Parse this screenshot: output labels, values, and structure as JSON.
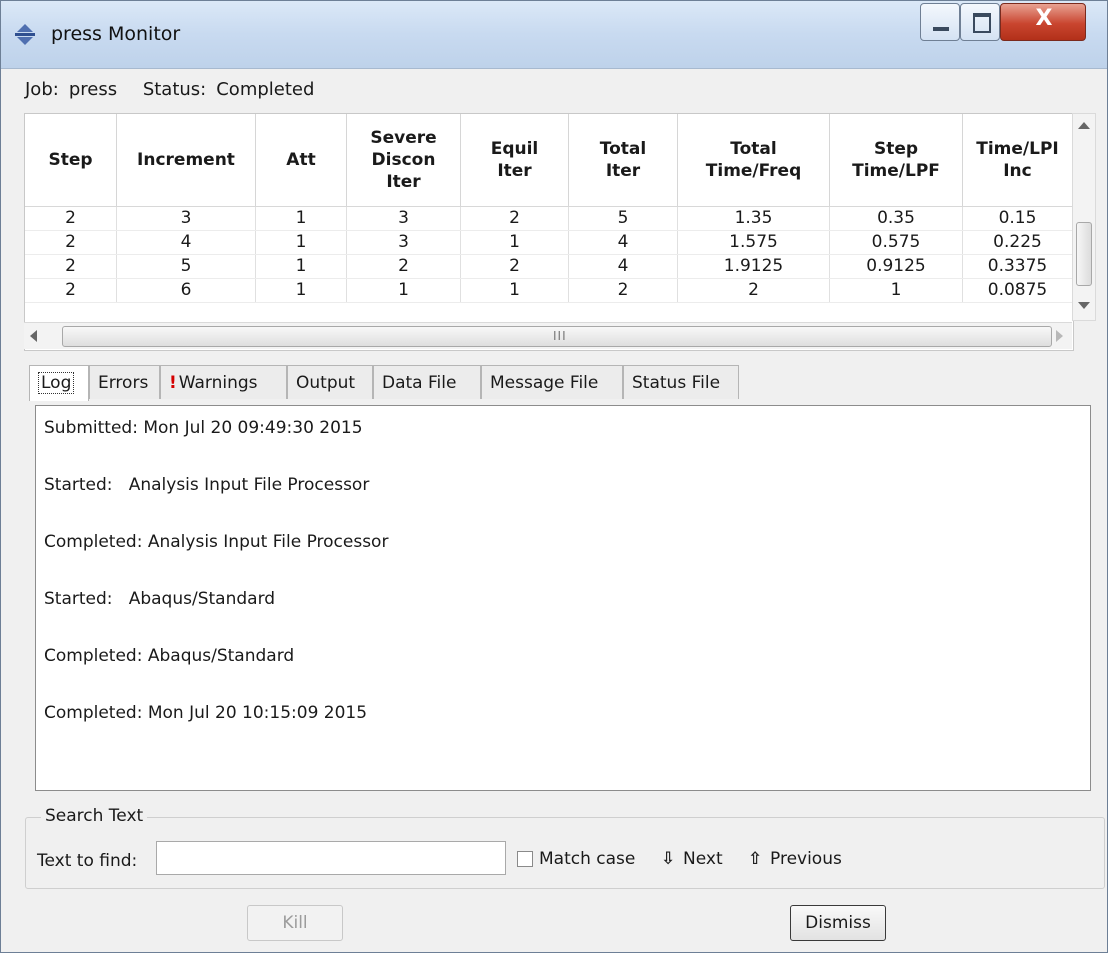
{
  "window": {
    "title": "press Monitor",
    "close_glyph": "X"
  },
  "job": {
    "job_label": "Job:",
    "job_value": "press",
    "status_label": "Status:",
    "status_value": "Completed"
  },
  "table": {
    "headers": [
      "Step",
      "Increment",
      "Att",
      "Severe Discon Iter",
      "Equil Iter",
      "Total Iter",
      "Total Time/Freq",
      "Step Time/LPF",
      "Time/LPI Inc"
    ],
    "rows": [
      [
        "2",
        "3",
        "1",
        "3",
        "2",
        "5",
        "1.35",
        "0.35",
        "0.15"
      ],
      [
        "2",
        "4",
        "1",
        "3",
        "1",
        "4",
        "1.575",
        "0.575",
        "0.225"
      ],
      [
        "2",
        "5",
        "1",
        "2",
        "2",
        "4",
        "1.9125",
        "0.9125",
        "0.3375"
      ],
      [
        "2",
        "6",
        "1",
        "1",
        "1",
        "2",
        "2",
        "1",
        "0.0875"
      ]
    ],
    "hscroll_grip": "III"
  },
  "tabs": [
    {
      "label": "Log",
      "active": true
    },
    {
      "label": "Errors"
    },
    {
      "label": "Warnings",
      "flag": "!"
    },
    {
      "label": "Output"
    },
    {
      "label": "Data File"
    },
    {
      "label": "Message File"
    },
    {
      "label": "Status File"
    }
  ],
  "log": [
    "Submitted: Mon Jul 20 09:49:30 2015",
    "Started:   Analysis Input File Processor",
    "Completed: Analysis Input File Processor",
    "Started:   Abaqus/Standard",
    "Completed: Abaqus/Standard",
    "Completed: Mon Jul 20 10:15:09 2015"
  ],
  "search": {
    "legend": "Search Text",
    "find_label": "Text to find:",
    "find_value": "",
    "match_case_label": "Match case",
    "match_case_checked": false,
    "next_label": "Next",
    "previous_label": "Previous",
    "next_icon": "arrow-down-icon",
    "previous_icon": "arrow-up-icon"
  },
  "buttons": {
    "kill_label": "Kill",
    "dismiss_label": "Dismiss"
  },
  "colors": {
    "titlebar": "#c8daf0",
    "close_button": "#c9452f",
    "warning_flag": "#d40000"
  }
}
